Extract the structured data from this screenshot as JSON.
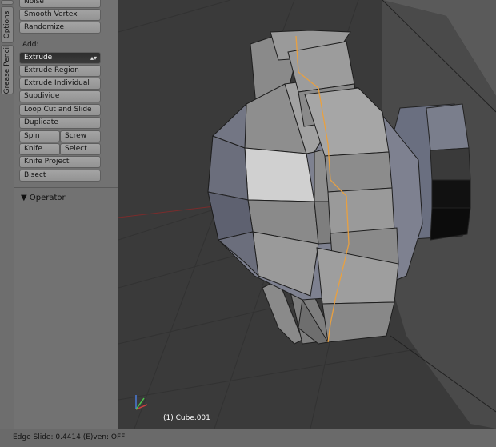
{
  "tabs": [
    "Options",
    "Grease Pencil"
  ],
  "tools": {
    "noise": "Noise",
    "smooth_vertex": "Smooth Vertex",
    "randomize": "Randomize",
    "add_label": "Add:",
    "extrude": "Extrude",
    "extrude_region": "Extrude Region",
    "extrude_individual": "Extrude Individual",
    "subdivide": "Subdivide",
    "loop_cut": "Loop Cut and Slide",
    "duplicate": "Duplicate",
    "spin": "Spin",
    "screw": "Screw",
    "knife": "Knife",
    "select": "Select",
    "knife_project": "Knife Project",
    "bisect": "Bisect"
  },
  "operator": {
    "header": "Operator"
  },
  "viewport": {
    "object_info": "(1) Cube.001"
  },
  "status": {
    "text": "Edge Slide: 0.4414 (E)ven: OFF"
  }
}
